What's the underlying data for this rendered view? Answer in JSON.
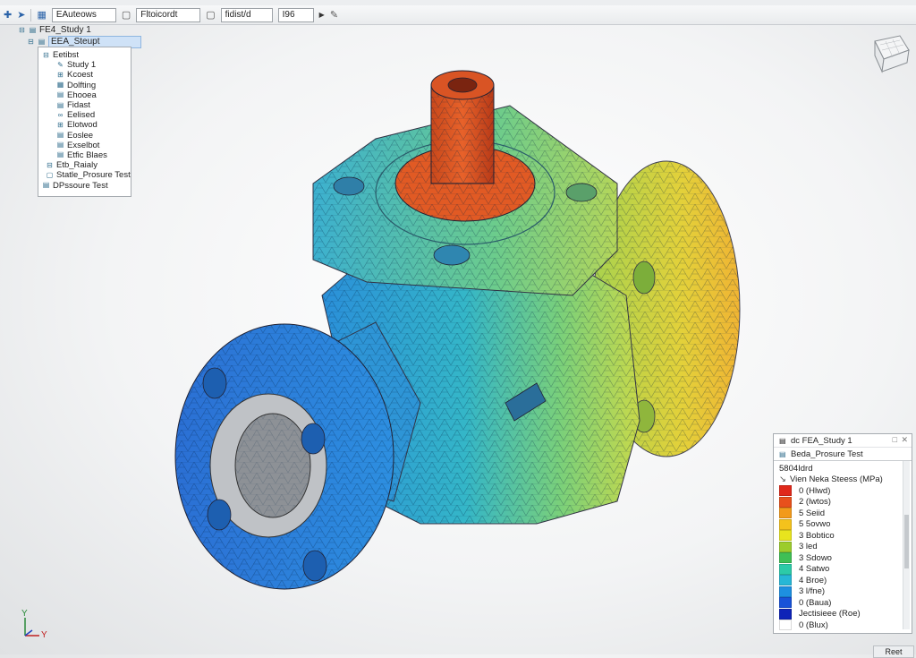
{
  "toolbar": {
    "field1": "EAuteows",
    "field2": "Fltoicordt",
    "field3": "fidist/d",
    "field4": "I96",
    "icons": [
      "plus-icon",
      "cursor-icon",
      "grid-icon",
      "dropdown-icon",
      "document-icon",
      "document-icon",
      "dropdown-icon",
      "pen-icon"
    ]
  },
  "tree": {
    "root_label": "FE4_Study 1",
    "selected_label": "EEA_Steupt",
    "items": [
      {
        "label": "Eetibst"
      },
      {
        "label": "Study 1"
      },
      {
        "label": "Kcoest"
      },
      {
        "label": "Dolfting"
      },
      {
        "label": "Ehooea"
      },
      {
        "label": "Fidast"
      },
      {
        "label": "Eelised"
      },
      {
        "label": "Elotwod"
      },
      {
        "label": "Eoslee"
      },
      {
        "label": "Exselbot"
      },
      {
        "label": "Etfic Blaes"
      },
      {
        "label": "Etb_Raialy"
      },
      {
        "label": "Statle_Prosure Test"
      },
      {
        "label": "DPssoure Test"
      }
    ]
  },
  "legend": {
    "title": "dc FEA_Study 1",
    "subtitle": "Beda_Prosure Test",
    "section": "5804Idrd",
    "quantity": "Vien Neka Steess (MPa)",
    "rows": [
      {
        "label": "0 (Hlwd)",
        "color": "#e0281a"
      },
      {
        "label": "2 (lwtos)",
        "color": "#e8501c"
      },
      {
        "label": "5 Seiid",
        "color": "#f29a1b"
      },
      {
        "label": "5 5ovwo",
        "color": "#f4c21c"
      },
      {
        "label": "3 Bobtico",
        "color": "#e8e41e"
      },
      {
        "label": "3 led",
        "color": "#9ccc2c"
      },
      {
        "label": "3 Sdowo",
        "color": "#3fbf55"
      },
      {
        "label": "4 Satwo",
        "color": "#2ccaa8"
      },
      {
        "label": "4 Broe)",
        "color": "#26b7d6"
      },
      {
        "label": "3 l/fne)",
        "color": "#1d8fe0"
      },
      {
        "label": "0 (Baua)",
        "color": "#1852d8"
      },
      {
        "label": "Jectisieee (Roe)",
        "color": "#0e23b8"
      },
      {
        "label": "0 (Blux)",
        "color": "#ffffff"
      }
    ]
  },
  "status": {
    "button": "Reet"
  },
  "triad": {
    "y_label": "Y",
    "x_label": "Y"
  }
}
